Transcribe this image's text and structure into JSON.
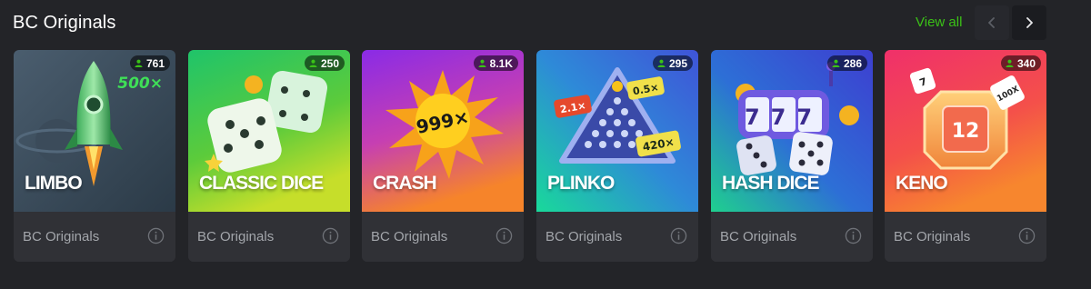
{
  "section": {
    "title": "BC Originals",
    "view_all": "View all",
    "prev_icon": "chevron-left-icon",
    "next_icon": "chevron-right-icon"
  },
  "colors": {
    "accent": "#3bc117",
    "background": "#232428",
    "card_footer": "#303136",
    "muted_text": "#a3a6ab"
  },
  "games": [
    {
      "title": "LIMBO",
      "players": "761",
      "provider": "BC Originals",
      "art_text": "500×"
    },
    {
      "title": "CLASSIC DICE",
      "players": "250",
      "provider": "BC Originals"
    },
    {
      "title": "CRASH",
      "players": "8.1K",
      "provider": "BC Originals",
      "art_text": "999×"
    },
    {
      "title": "PLINKO",
      "players": "295",
      "provider": "BC Originals",
      "art_labels": [
        "2.1×",
        "0.5×",
        "420×"
      ]
    },
    {
      "title": "HASH DICE",
      "players": "286",
      "provider": "BC Originals",
      "art_text": "777"
    },
    {
      "title": "KENO",
      "players": "340",
      "provider": "BC Originals",
      "art_labels": [
        "12",
        "7",
        "100X"
      ]
    }
  ]
}
